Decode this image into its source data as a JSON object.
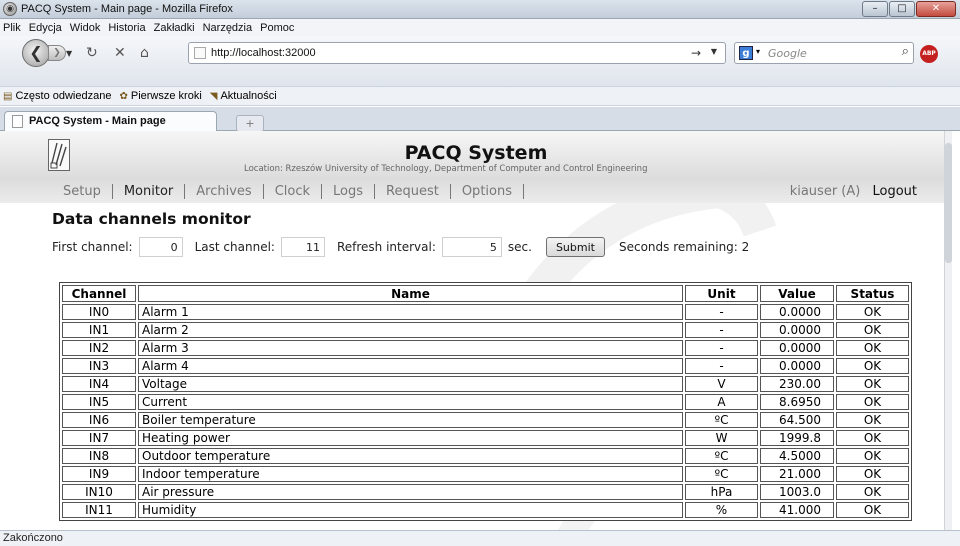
{
  "window": {
    "title": "PACQ System - Main page - Mozilla Firefox"
  },
  "menubar": [
    "Plik",
    "Edycja",
    "Widok",
    "Historia",
    "Zakładki",
    "Narzędzia",
    "Pomoc"
  ],
  "navbar": {
    "url": "http://localhost:32000",
    "search_placeholder": "Google",
    "adblock_label": "ABP"
  },
  "bookmarks": [
    "Często odwiedzane",
    "Pierwsze kroki",
    "Aktualności"
  ],
  "tab": {
    "label": "PACQ System - Main page",
    "new_tab": "+"
  },
  "status": {
    "text": "Zakończono"
  },
  "page": {
    "site_title": "PACQ System",
    "location": "Location: Rzeszów University of Technology, Department of Computer and Control Engineering",
    "menu": [
      "Setup",
      "Monitor",
      "Archives",
      "Clock",
      "Logs",
      "Request",
      "Options"
    ],
    "active_menu": "Monitor",
    "user": "kiauser (A)",
    "logout": "Logout",
    "heading": "Data channels monitor",
    "form": {
      "first_label": "First channel:",
      "first_value": "0",
      "last_label": "Last channel:",
      "last_value": "11",
      "refresh_label": "Refresh interval:",
      "refresh_value": "5",
      "refresh_unit": "sec.",
      "submit": "Submit",
      "remaining_label": "Seconds remaining:",
      "remaining_value": "2"
    },
    "table": {
      "headers": [
        "Channel",
        "Name",
        "Unit",
        "Value",
        "Status"
      ],
      "rows": [
        [
          "IN0",
          "Alarm 1",
          "-",
          "0.0000",
          "OK"
        ],
        [
          "IN1",
          "Alarm 2",
          "-",
          "0.0000",
          "OK"
        ],
        [
          "IN2",
          "Alarm 3",
          "-",
          "0.0000",
          "OK"
        ],
        [
          "IN3",
          "Alarm 4",
          "-",
          "0.0000",
          "OK"
        ],
        [
          "IN4",
          "Voltage",
          "V",
          "230.00",
          "OK"
        ],
        [
          "IN5",
          "Current",
          "A",
          "8.6950",
          "OK"
        ],
        [
          "IN6",
          "Boiler temperature",
          "ºC",
          "64.500",
          "OK"
        ],
        [
          "IN7",
          "Heating power",
          "W",
          "1999.8",
          "OK"
        ],
        [
          "IN8",
          "Outdoor temperature",
          "ºC",
          "4.5000",
          "OK"
        ],
        [
          "IN9",
          "Indoor temperature",
          "ºC",
          "21.000",
          "OK"
        ],
        [
          "IN10",
          "Air pressure",
          "hPa",
          "1003.0",
          "OK"
        ],
        [
          "IN11",
          "Humidity",
          "%",
          "41.000",
          "OK"
        ]
      ]
    }
  }
}
